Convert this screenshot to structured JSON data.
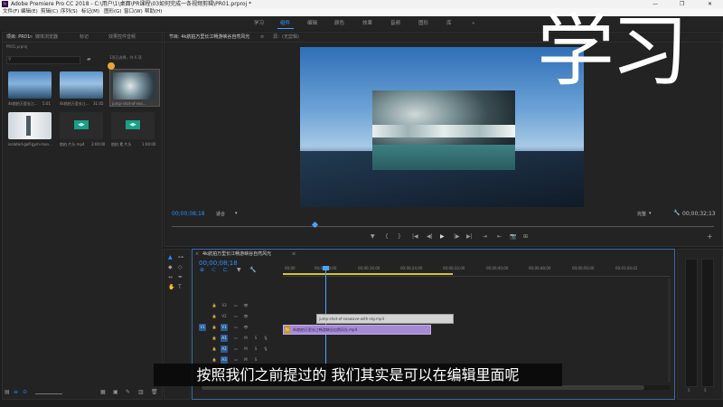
{
  "titlebar": {
    "app_icon": "Pr",
    "title": "Adobe Premiere Pro CC 2018 - C:\\用户\\1\\桌面\\PR课程\\03如何完成一条视频剪辑\\PR01.prproj *",
    "minimize": "—",
    "maximize": "❐",
    "close": "✕"
  },
  "menubar": {
    "items": [
      "文件(F)",
      "编辑(E)",
      "剪辑(C)",
      "序列(S)",
      "标记(M)",
      "图形(G)",
      "窗口(W)",
      "帮助(H)"
    ]
  },
  "workspaces": {
    "items": [
      "学习",
      "组件",
      "编辑",
      "颜色",
      "效果",
      "音频",
      "图形",
      "库"
    ],
    "active": "组件",
    "more": "»"
  },
  "project": {
    "tabs": [
      "项目: PR01",
      "媒体浏览器",
      "标记",
      "效果控件音频"
    ],
    "menu_icon": "≡",
    "path_label": "项目: PR01",
    "file_name": "PR01.prproj",
    "search_placeholder": "",
    "selection_info": "1项已选择，共 6 项",
    "items": [
      {
        "name": "4k航拍万里长江...",
        "duration": "5:01"
      },
      {
        "name": "4k航拍万里长江...",
        "duration": "31:05"
      },
      {
        "name": "jump-shot-of-sea...",
        "duration": "0:00"
      },
      {
        "name": "isolated-golf-gym-man...",
        "duration": "12:07"
      },
      {
        "name": "航拍 片头.mp4",
        "duration": "3:00:00"
      },
      {
        "name": "航拍 素 片头",
        "duration": "1:00:00"
      }
    ],
    "audio_icon": "◀▶",
    "status_icons": [
      "▤",
      "≡",
      "⊙",
      "▦",
      "▣",
      "✎",
      "▥",
      "🗑"
    ]
  },
  "program": {
    "tabs": [
      "节目: 4k航拍万里长江畅游峡谷自然风光",
      "源：(无剪辑)"
    ],
    "menu_icon": "≡",
    "timecode": "00;00;08;18",
    "fit": "适合",
    "quality": "完整",
    "duration": "00;00;32;13",
    "wrench_icon": "🔧",
    "controls": [
      "▼",
      "{",
      "}",
      "|◀",
      "◀|",
      "▶",
      "|▶",
      "▶|",
      "⇥",
      "⇤",
      "📷",
      "⊞"
    ],
    "add_icon": "+"
  },
  "timeline": {
    "close_icon": "×",
    "sequence_name": "4k航拍万里长江畅游峡谷自然风光",
    "menu_icon": "≡",
    "timecode": "00;00;08;18",
    "tool_icons": [
      "⊕",
      "⊂",
      "⊏",
      "▼",
      "🔧"
    ],
    "ruler_labels": [
      "00;00",
      "00;00;08;00",
      "00;00;16;00",
      "00;00;24;00",
      "00;00;32;00",
      "00;00;40;00",
      "00;00;48;00",
      "00;00;56;00",
      "00;01;04;02"
    ],
    "tracks": [
      {
        "name": "V3",
        "type": "video"
      },
      {
        "name": "V2",
        "type": "video"
      },
      {
        "name": "V1",
        "type": "video"
      },
      {
        "name": "A1",
        "type": "audio"
      },
      {
        "name": "A2",
        "type": "audio"
      },
      {
        "name": "A3",
        "type": "audio"
      }
    ],
    "track_btn_m": "M",
    "track_btn_s": "S",
    "lock_icon": "🔒",
    "eye_icon": "👁",
    "mic_icon": "🎙",
    "clip_v2": "jump-shot-of-seawave-with-sky.mp4",
    "clip_v1": "4k航拍万里长江畅游峡谷自然风光.mp4",
    "clip_fx": "fx"
  },
  "tools": {
    "icons": [
      "▲",
      "⊶",
      "◆",
      "↔",
      "✒",
      "✋",
      "T"
    ]
  },
  "audio_meter": {
    "labels": [
      "S",
      "S"
    ]
  },
  "overlay": {
    "big_text": "学习",
    "subtitle": "按照我们之前提过的 我们其实是可以在编辑里面呢"
  },
  "colors": {
    "accent": "#2d8cff",
    "clip_video": "#a58bd4",
    "clip_overlay": "#d3d3d3",
    "playhead": "#4aa3ff"
  }
}
